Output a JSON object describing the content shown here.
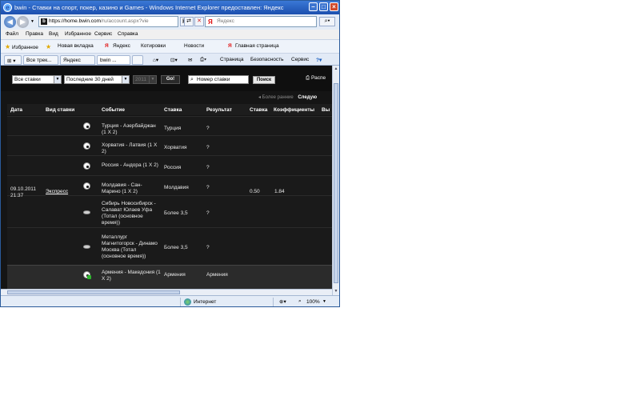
{
  "window": {
    "title": "bwin - Ставки на спорт, покер, казино и Games - Windows Internet Explorer предоставлен: Яндекс",
    "url_domain": "https://home.bwin.com",
    "url_rest": "/ru/account.aspx?vie",
    "search_placeholder": "Яндекс"
  },
  "menu": [
    "Файл",
    "Правка",
    "Вид",
    "Избранное",
    "Сервис",
    "Справка"
  ],
  "favorites_bar": {
    "favorites": "Избранное",
    "items": [
      "Новая вкладка",
      "Яндекс",
      "Котировки",
      "Новости",
      "Главная страница"
    ]
  },
  "tabs": [
    "Все трек...",
    "Яндекс",
    "bwin ..."
  ],
  "commands": [
    "Страница",
    "Безопасность",
    "Сервис"
  ],
  "filters": {
    "bet_type": "Все ставки",
    "period": "Последние 30 дней",
    "year": "2011",
    "go_label": "Go!",
    "search_placeholder": "Номер ставки",
    "search_button": "Поиск",
    "print_label": "Распе"
  },
  "pager": {
    "prev": "◂ Более ранние",
    "next": "Следую"
  },
  "table": {
    "headers": [
      "Дата",
      "Вид ставки",
      "Событие",
      "Ставка",
      "Результат",
      "Ставка",
      "Коэффициенты",
      "Вы"
    ],
    "group": {
      "date": "09.10.2011 21:37",
      "bet_kind": "Экспресс",
      "stake": "0.50",
      "odds": "1.84"
    },
    "rows": [
      {
        "sport": "football",
        "event": "Турция - Азербайджан (1 X 2)",
        "bet": "Турция",
        "result": "?"
      },
      {
        "sport": "football",
        "event": "Хорватия - Латвия (1 X 2)",
        "bet": "Хорватия",
        "result": "?"
      },
      {
        "sport": "football",
        "event": "Россия - Андора (1 X 2)",
        "bet": "Россия",
        "result": "?"
      },
      {
        "sport": "football",
        "event": "Молдавия - Сан-Марино (1 X 2)",
        "bet": "Молдавия",
        "result": "?"
      },
      {
        "sport": "hockey",
        "event": "Сибирь Новосибирск - Салават Юлаев Уфа (Тотал (основное время))",
        "bet": "Более 3,5",
        "result": "?"
      },
      {
        "sport": "hockey",
        "event": "Металлург Магнитогорск - Динамо Москва (Тотал (основное время))",
        "bet": "Более 3,5",
        "result": "?"
      }
    ],
    "last_row": {
      "event": "Армения - Македония (1 X 2)",
      "bet": "Армения",
      "result": "Армения"
    }
  },
  "status": {
    "zone": "Интернет",
    "zoom": "100%"
  }
}
